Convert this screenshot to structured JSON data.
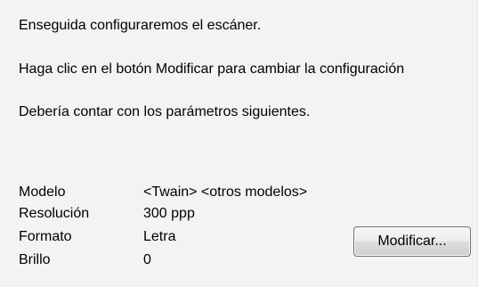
{
  "intro": {
    "line1": "Enseguida configuraremos el escáner.",
    "line2": "Haga clic en el botón Modificar para cambiar la configuración",
    "line3": "Debería contar con los parámetros siguientes."
  },
  "settings": [
    {
      "label": "Modelo",
      "value": "<Twain> <otros modelos>"
    },
    {
      "label": "Resolución",
      "value": "300 ppp"
    },
    {
      "label": "Formato",
      "value": "Letra"
    },
    {
      "label": "Brillo",
      "value": "0"
    }
  ],
  "buttons": {
    "modify": "Modificar..."
  }
}
